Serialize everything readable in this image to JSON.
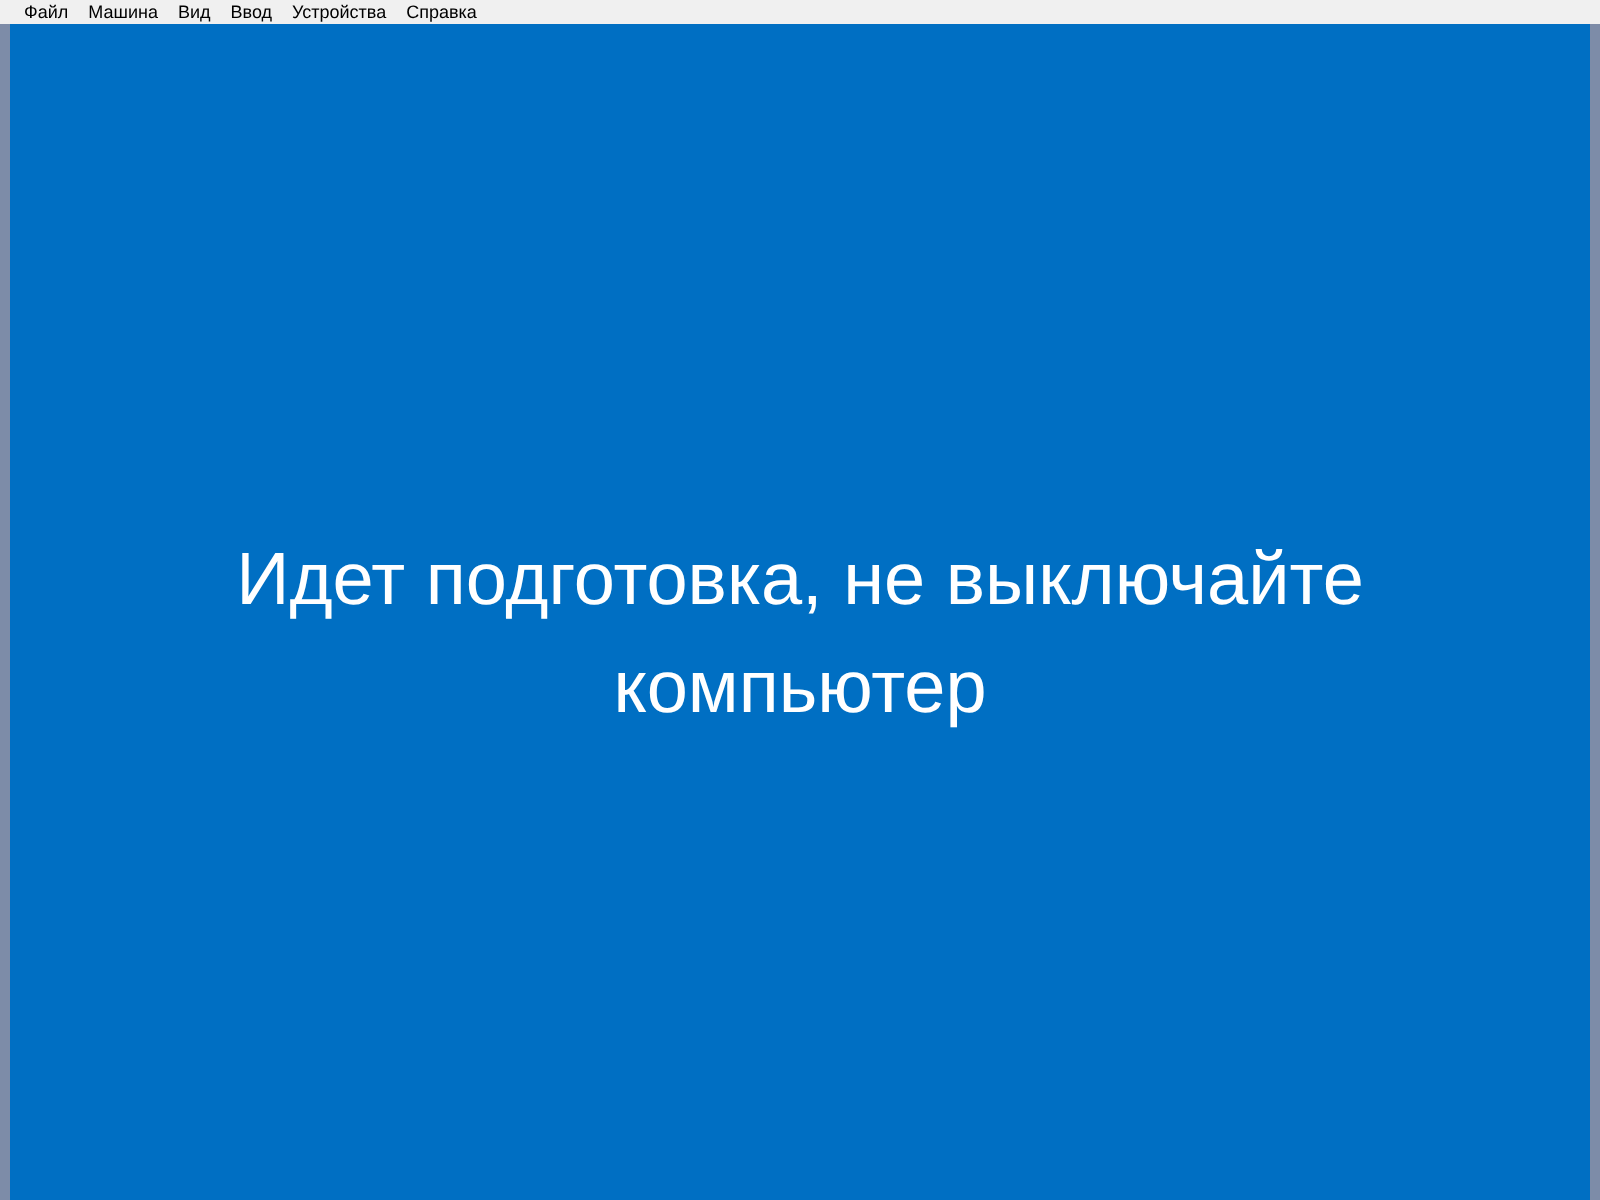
{
  "menu_bar": [
    "Файл",
    "Машина",
    "Вид",
    "Ввод",
    "Устройства",
    "Справка"
  ],
  "message": "Идет подготовка, не выключайте компьютер"
}
